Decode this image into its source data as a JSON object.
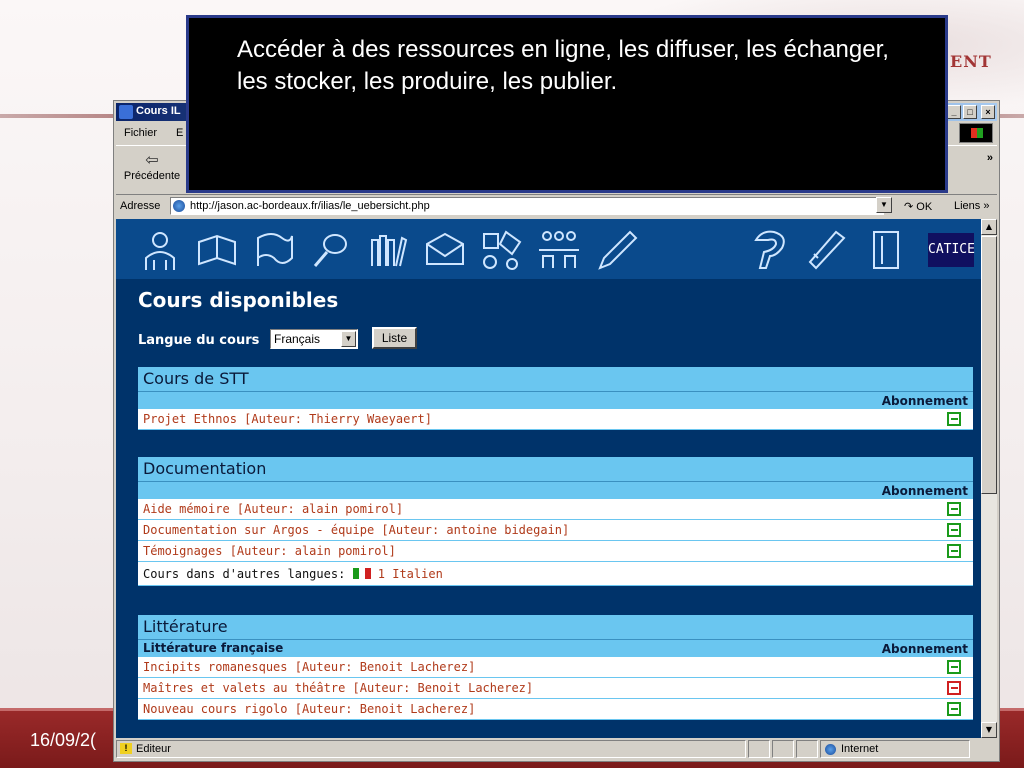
{
  "slide": {
    "brand_text": "ENT",
    "date": "16/09/2("
  },
  "callout": {
    "text": "Accéder à des ressources en ligne, les diffuser, les échanger, les stocker, les produire, les publier."
  },
  "window": {
    "title": "Cours IL",
    "controls": {
      "minimize": "_",
      "maximize": "□",
      "close": "×"
    }
  },
  "menu": {
    "fichier": "Fichier",
    "edition": "E"
  },
  "toolbar": {
    "back_label": "Précédente",
    "more": "»"
  },
  "address": {
    "label": "Adresse",
    "url": "http://jason.ac-bordeaux.fr/ilias/le_uebersicht.php",
    "go": "OK",
    "links": "Liens »"
  },
  "nav_icons": [
    "person-icon",
    "book-icon",
    "flag-icon",
    "search-icon",
    "library-icon",
    "mail-icon",
    "puzzle-icon",
    "group-icon",
    "pencil-icon",
    "help-icon",
    "ruler-icon",
    "door-icon"
  ],
  "brand_badge": "CATICE",
  "page": {
    "title": "Cours disponibles",
    "lang_label": "Langue du cours",
    "lang_value": "Français",
    "liste_button": "Liste"
  },
  "categories": [
    {
      "name": "Cours de STT",
      "sub_left": "",
      "sub_right": "Abonnement",
      "rows": [
        {
          "text": "Projet Ethnos [Auteur: Thierry Waeyaert]",
          "status": "subscribe"
        }
      ]
    },
    {
      "name": "Documentation",
      "sub_left": "",
      "sub_right": "Abonnement",
      "rows": [
        {
          "text": "Aide mémoire [Auteur: alain pomirol]",
          "status": "subscribe"
        },
        {
          "text": "Documentation sur Argos - équipe [Auteur: antoine bidegain]",
          "status": "subscribe"
        },
        {
          "text": "Témoignages [Auteur: alain pomirol]",
          "status": "subscribe"
        }
      ],
      "other_lang_label": "Cours dans d'autres langues:",
      "other_lang_link": "1 Italien"
    },
    {
      "name": "Littérature",
      "sub_left": "Littérature française",
      "sub_right": "Abonnement",
      "rows": [
        {
          "text": "Incipits romanesques [Auteur: Benoit Lacherez]",
          "status": "subscribe"
        },
        {
          "text": "Maîtres et valets au théâtre [Auteur: Benoit Lacherez]",
          "status": "unsubscribe"
        },
        {
          "text": "Nouveau cours rigolo [Auteur: Benoit Lacherez]",
          "status": "subscribe"
        }
      ]
    }
  ],
  "status": {
    "text": "Editeur",
    "zone": "Internet"
  },
  "colors": {
    "page_bg": "#00336a",
    "category_bg": "#6ac6f0",
    "link": "#b03a1a",
    "callout_bg": "#000000"
  }
}
